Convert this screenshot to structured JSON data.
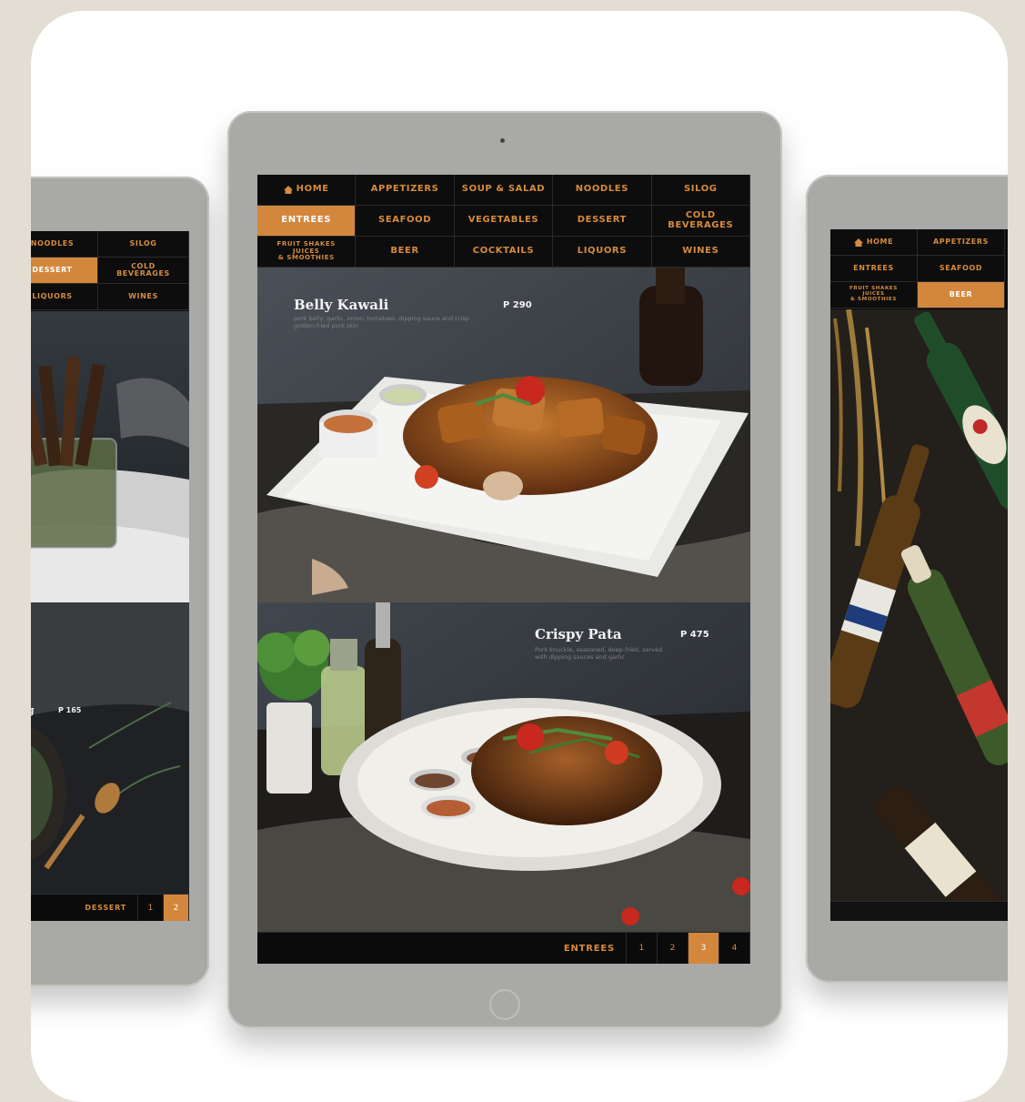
{
  "center": {
    "nav": [
      {
        "label": "HOME",
        "icon": "home-icon"
      },
      {
        "label": "APPETIZERS"
      },
      {
        "label": "SOUP & SALAD"
      },
      {
        "label": "NOODLES"
      },
      {
        "label": "SILOG"
      },
      {
        "label": "ENTREES",
        "active": true
      },
      {
        "label": "SEAFOOD"
      },
      {
        "label": "VEGETABLES"
      },
      {
        "label": "DESSERT"
      },
      {
        "label": "COLD\nBEVERAGES"
      },
      {
        "label": "FRUIT SHAKES\nJUICES\n& SMOOTHIES",
        "small": true
      },
      {
        "label": "BEER"
      },
      {
        "label": "COCKTAILS"
      },
      {
        "label": "LIQUORS"
      },
      {
        "label": "WINES"
      }
    ],
    "items": [
      {
        "name": "Belly Kawali",
        "price": "P 290",
        "description": "pork belly, garlic, onion, tomatoes, dipping sauce and crisp golden-fried pork skin"
      },
      {
        "name": "Crispy Pata",
        "price": "P 475",
        "description": "Pork knuckle, seasoned, deep-fried, served with dipping sauces and garlic"
      }
    ],
    "pager": {
      "category": "ENTREES",
      "pages": [
        "1",
        "2",
        "3",
        "4"
      ],
      "active": "3"
    }
  },
  "left": {
    "nav": [
      {
        "label": "NOODLES"
      },
      {
        "label": "SILOG"
      },
      {
        "label": "DESSERT",
        "active": true
      },
      {
        "label": "COLD\nBEVERAGES"
      },
      {
        "label": "LIQUORS"
      },
      {
        "label": "WINES"
      }
    ],
    "item": {
      "name": "ding",
      "price": "P 165"
    },
    "pager": {
      "category": "DESSERT",
      "pages": [
        "1",
        "2"
      ],
      "active": "2"
    }
  },
  "right": {
    "nav": [
      {
        "label": "HOME",
        "icon": "home-icon"
      },
      {
        "label": "APPETIZERS"
      },
      {
        "label": "ENTREES"
      },
      {
        "label": "SEAFOOD"
      },
      {
        "label": "FRUIT SHAKES\nJUICES\n& SMOOTHIES",
        "small": true
      },
      {
        "label": "BEER",
        "active": true
      }
    ]
  },
  "colors": {
    "accent": "#d3873d",
    "nav_bg": "#0d0d0d",
    "frame": "#a9a9a7",
    "backdrop": "#e2ded4"
  }
}
